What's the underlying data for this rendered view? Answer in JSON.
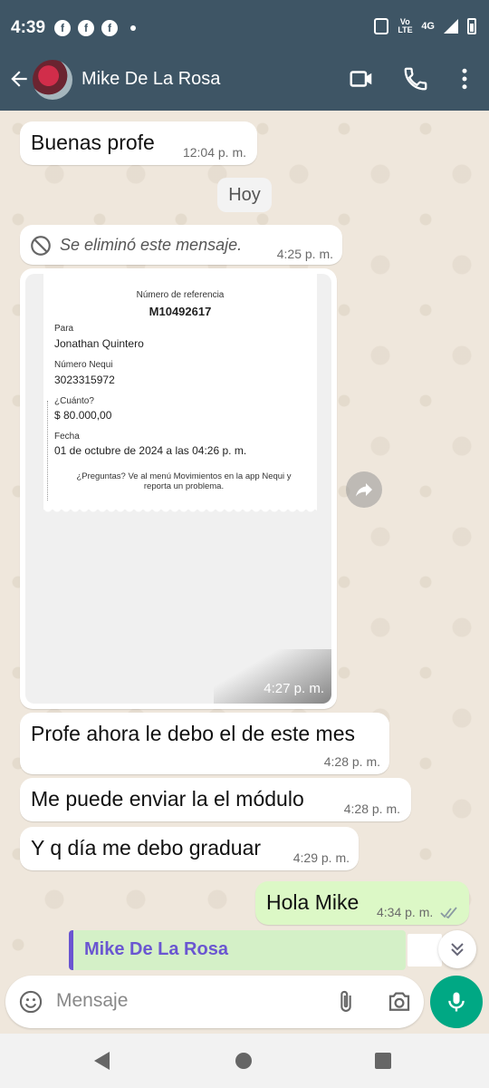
{
  "status_bar": {
    "time": "4:39",
    "network": "4G",
    "volte": "Vo LTE"
  },
  "header": {
    "contact_name": "Mike De La Rosa"
  },
  "messages": {
    "m1": {
      "text": "Buenas profe",
      "time": "12:04 p. m."
    },
    "day_separator": "Hoy",
    "m2": {
      "text": "Se eliminó este mensaje.",
      "time": "4:25 p. m."
    },
    "image": {
      "time": "4:27 p. m.",
      "receipt": {
        "ref_label": "Número de referencia",
        "ref_value": "M10492617",
        "to_label": "Para",
        "to_value": "Jonathan Quintero",
        "num_label": "Número Nequi",
        "num_value": "3023315972",
        "amount_label": "¿Cuánto?",
        "amount_value": "$ 80.000,00",
        "date_label": "Fecha",
        "date_value": "01 de octubre de 2024 a las 04:26 p. m.",
        "help_text": "¿Preguntas? Ve al menú Movimientos en la app Nequi y reporta un problema."
      }
    },
    "m3": {
      "text": "Profe ahora le debo el de este mes",
      "time": "4:28 p. m."
    },
    "m4": {
      "text": "Me puede enviar la el módulo",
      "time": "4:28 p. m."
    },
    "m5": {
      "text": "Y q día me debo graduar",
      "time": "4:29 p. m."
    },
    "m6": {
      "text": "Hola Mike",
      "time": "4:34 p. m."
    }
  },
  "reply_preview": {
    "name": "Mike De La Rosa"
  },
  "composer": {
    "placeholder": "Mensaje"
  },
  "colors": {
    "header": "#3e5565",
    "outgoing": "#dcf8c6",
    "accent": "#00a884",
    "reply_bar": "#6a56d1"
  },
  "icons": [
    "back-arrow-icon",
    "video-call-icon",
    "phone-icon",
    "more-options-icon",
    "blocked-icon",
    "forward-icon",
    "chevron-down-icon",
    "emoji-icon",
    "attach-icon",
    "camera-icon",
    "mic-icon"
  ]
}
